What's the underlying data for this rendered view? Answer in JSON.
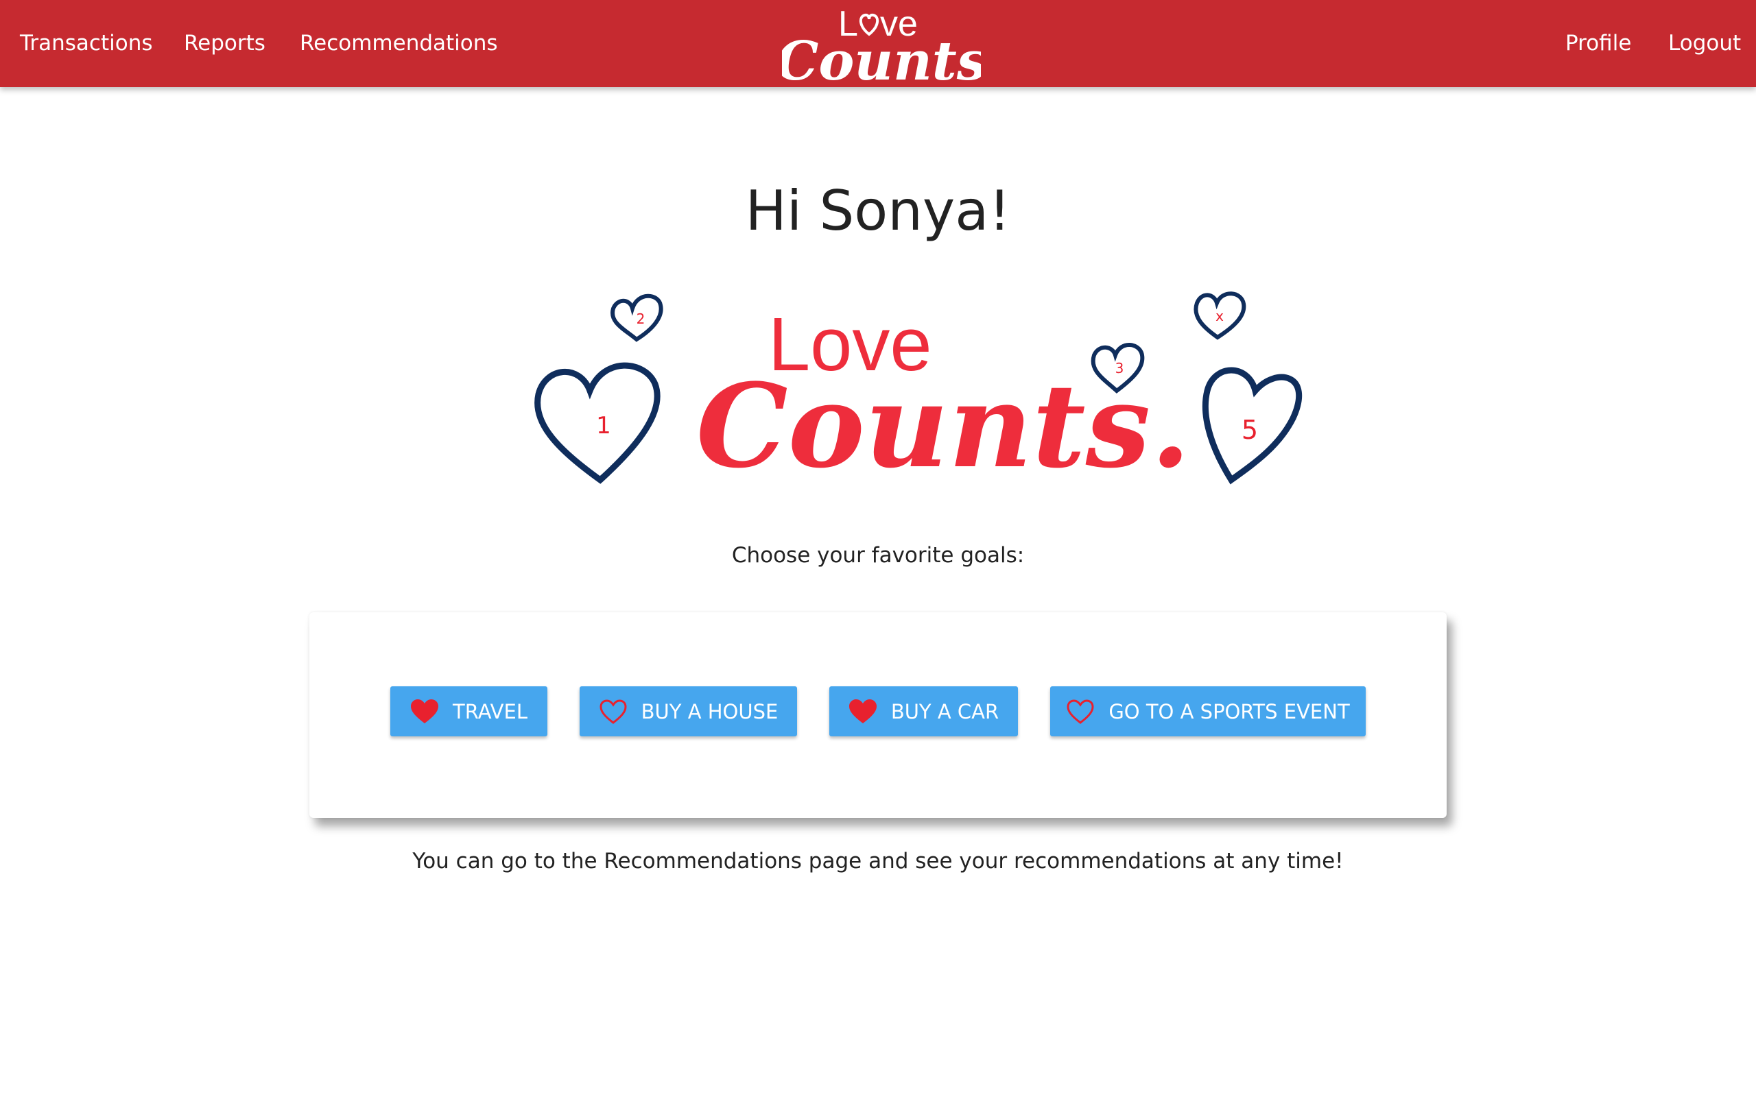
{
  "nav": {
    "left_links": [
      "Transactions",
      "Reports",
      "Recommendations"
    ],
    "right_links": [
      "Profile",
      "Logout"
    ],
    "brand": {
      "line1": "Love",
      "line2": "Counts",
      "icon": "heart-in-o-icon"
    }
  },
  "greeting": "Hi Sonya!",
  "hero": {
    "line1": "Love",
    "line2": "Counts.",
    "heart_numbers": [
      "1",
      "2",
      "3",
      "x",
      "5"
    ]
  },
  "goals": {
    "prompt": "Choose your favorite goals:",
    "items": [
      {
        "label": "TRAVEL",
        "selected": true,
        "icon": "heart-filled-icon"
      },
      {
        "label": "BUY A HOUSE",
        "selected": false,
        "icon": "heart-outline-icon"
      },
      {
        "label": "BUY A CAR",
        "selected": true,
        "icon": "heart-filled-icon"
      },
      {
        "label": "GO TO A SPORTS EVENT",
        "selected": false,
        "icon": "heart-outline-icon"
      }
    ]
  },
  "footer_note": "You can go to the Recommendations page and see your recommendations at any time!",
  "colors": {
    "navbar": "#c62a30",
    "button": "#46a6ee",
    "heart_red": "#e8212e",
    "heart_navy": "#0f2d5c",
    "logo_red": "#ee2d3c"
  }
}
